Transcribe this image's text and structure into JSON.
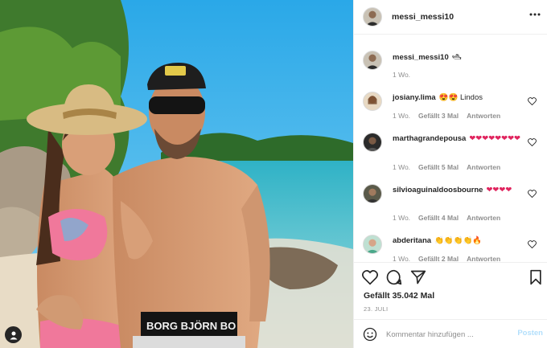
{
  "post": {
    "photo_icon": "person-icon",
    "accent": "#0095f6"
  },
  "header": {
    "username": "messi_messi10",
    "more_icon": "more-dots-icon"
  },
  "caption": {
    "username": "messi_messi10",
    "emoji": "🛥",
    "time": "1 Wo."
  },
  "comments": [
    {
      "username": "josiany.lima",
      "text": "😍😍 Lindos",
      "time": "1 Wo.",
      "likes": "Gefällt 3 Mal",
      "reply": "Antworten"
    },
    {
      "username": "marthagrandepousa",
      "text": "❤❤❤❤❤❤❤❤",
      "time": "1 Wo.",
      "likes": "Gefällt 5 Mal",
      "reply": "Antworten"
    },
    {
      "username": "silvioaguinaldoosbourne",
      "text": "❤❤❤❤",
      "time": "1 Wo.",
      "likes": "Gefällt 4 Mal",
      "reply": "Antworten"
    },
    {
      "username": "abderitana",
      "text": "👏👏👏👏🔥",
      "time": "1 Wo.",
      "likes": "Gefällt 2 Mal",
      "reply": "Antworten"
    }
  ],
  "actions": {
    "likes": "Gefällt 35.042 Mal",
    "date": "23. JULI"
  },
  "composer": {
    "placeholder": "Kommentar hinzufügen ...",
    "post_label": "Posten"
  }
}
